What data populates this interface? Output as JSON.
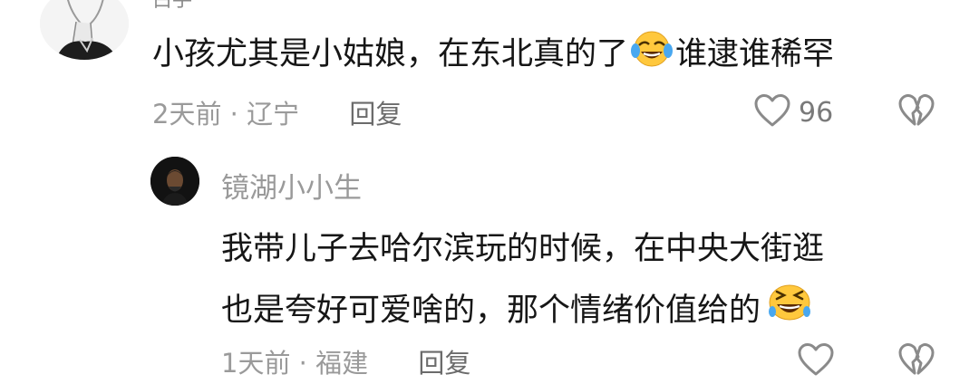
{
  "comments": [
    {
      "author": "白手",
      "text_before_emoji": "小孩尤其是小姑娘，在东北真的了",
      "emoji": "face-with-tears-of-joy-icon",
      "text_after_emoji": "谁逮谁稀罕",
      "time": "2天前",
      "location": "辽宁",
      "reply_label": "回复",
      "like_count": "96"
    },
    {
      "author": "镜湖小小生",
      "text_line1": "我带儿子去哈尔滨玩的时候，在中央大街逛",
      "text_line2": "也是夸好可爱啥的，那个情绪价值给的",
      "emoji": "grinning-squinting-sweat-icon",
      "time": "1天前",
      "location": "福建",
      "reply_label": "回复"
    }
  ],
  "separator": " · "
}
